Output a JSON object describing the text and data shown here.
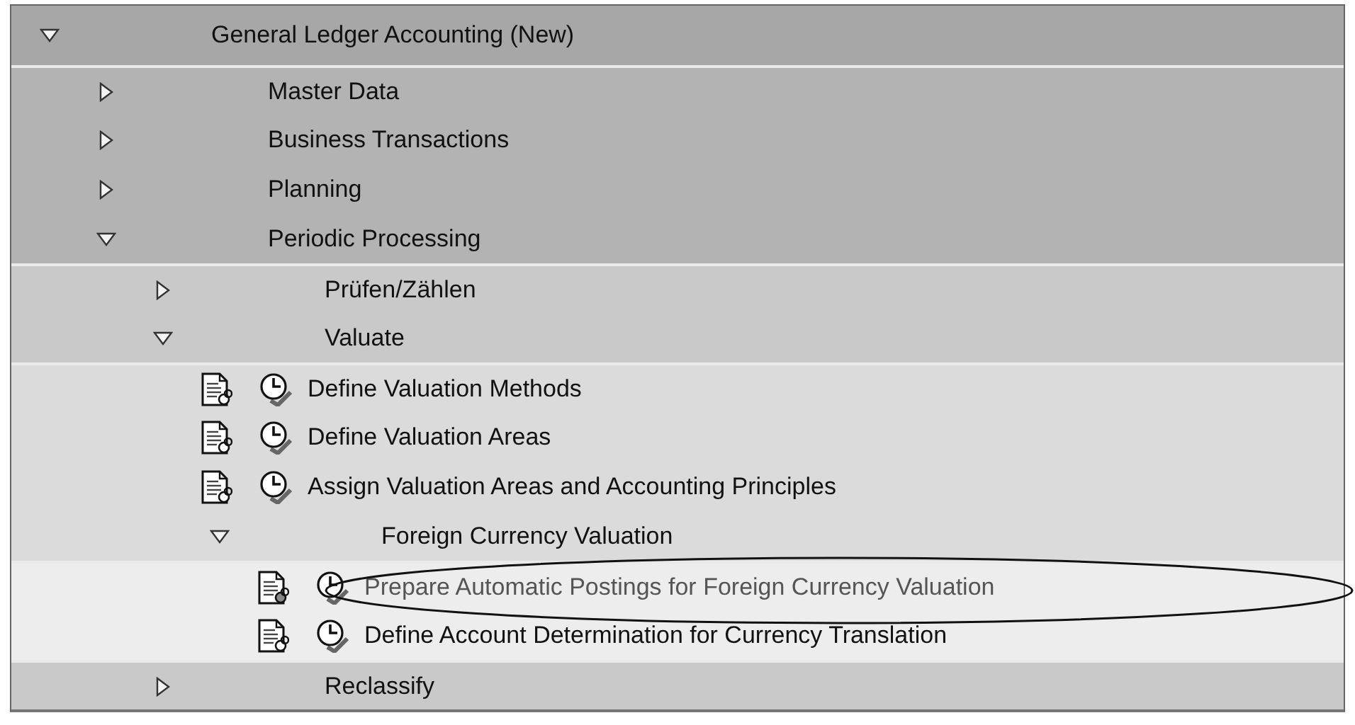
{
  "tree": [
    {
      "label": "General Ledger Accounting (New)",
      "kind": "folder",
      "expanded": true,
      "children": [
        {
          "label": "Master Data",
          "kind": "folder",
          "expanded": false
        },
        {
          "label": "Business Transactions",
          "kind": "folder",
          "expanded": false
        },
        {
          "label": "Planning",
          "kind": "folder",
          "expanded": false
        },
        {
          "label": "Periodic Processing",
          "kind": "folder",
          "expanded": true,
          "children": [
            {
              "label": "Prüfen/Zählen",
              "kind": "folder",
              "expanded": false
            },
            {
              "label": "Valuate",
              "kind": "folder",
              "expanded": true,
              "children": [
                {
                  "label": "Define Valuation Methods",
                  "kind": "activity",
                  "selected": false
                },
                {
                  "label": "Define Valuation Areas",
                  "kind": "activity",
                  "selected": false
                },
                {
                  "label": "Assign Valuation Areas and Accounting Principles",
                  "kind": "activity",
                  "selected": false
                },
                {
                  "label": "Foreign Currency Valuation",
                  "kind": "folder",
                  "expanded": true,
                  "children": [
                    {
                      "label": "Prepare Automatic Postings for Foreign Currency Valuation",
                      "kind": "activity",
                      "selected": true
                    },
                    {
                      "label": "Define Account Determination for Currency Translation",
                      "kind": "activity",
                      "selected": false
                    }
                  ]
                }
              ]
            },
            {
              "label": "Reclassify",
              "kind": "folder",
              "expanded": false
            }
          ]
        }
      ]
    }
  ]
}
